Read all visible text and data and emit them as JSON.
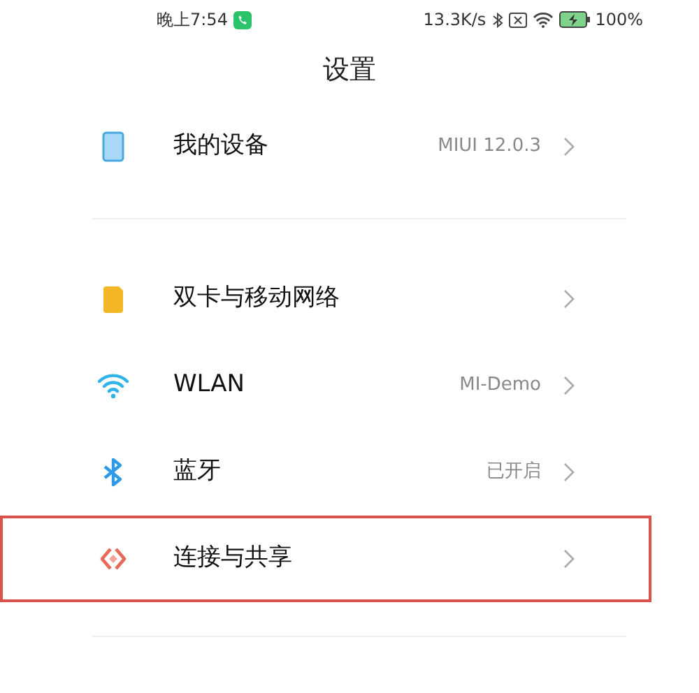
{
  "status_bar": {
    "time": "晚上7:54",
    "speed": "13.3K/s",
    "battery": "100%"
  },
  "title": "设置",
  "sections": [
    {
      "items": [
        {
          "kind": "device",
          "label": "我的设备",
          "value": "MIUI 12.0.3",
          "highlighted": false
        }
      ]
    },
    {
      "items": [
        {
          "kind": "sim",
          "label": "双卡与移动网络",
          "highlighted": false
        },
        {
          "kind": "wifi",
          "label": "WLAN",
          "value": "MI-Demo",
          "highlighted": false
        },
        {
          "kind": "bluetooth",
          "label": "蓝牙",
          "value": "已开启",
          "highlighted": false
        },
        {
          "kind": "share",
          "label": "连接与共享",
          "highlighted": true
        }
      ]
    }
  ]
}
